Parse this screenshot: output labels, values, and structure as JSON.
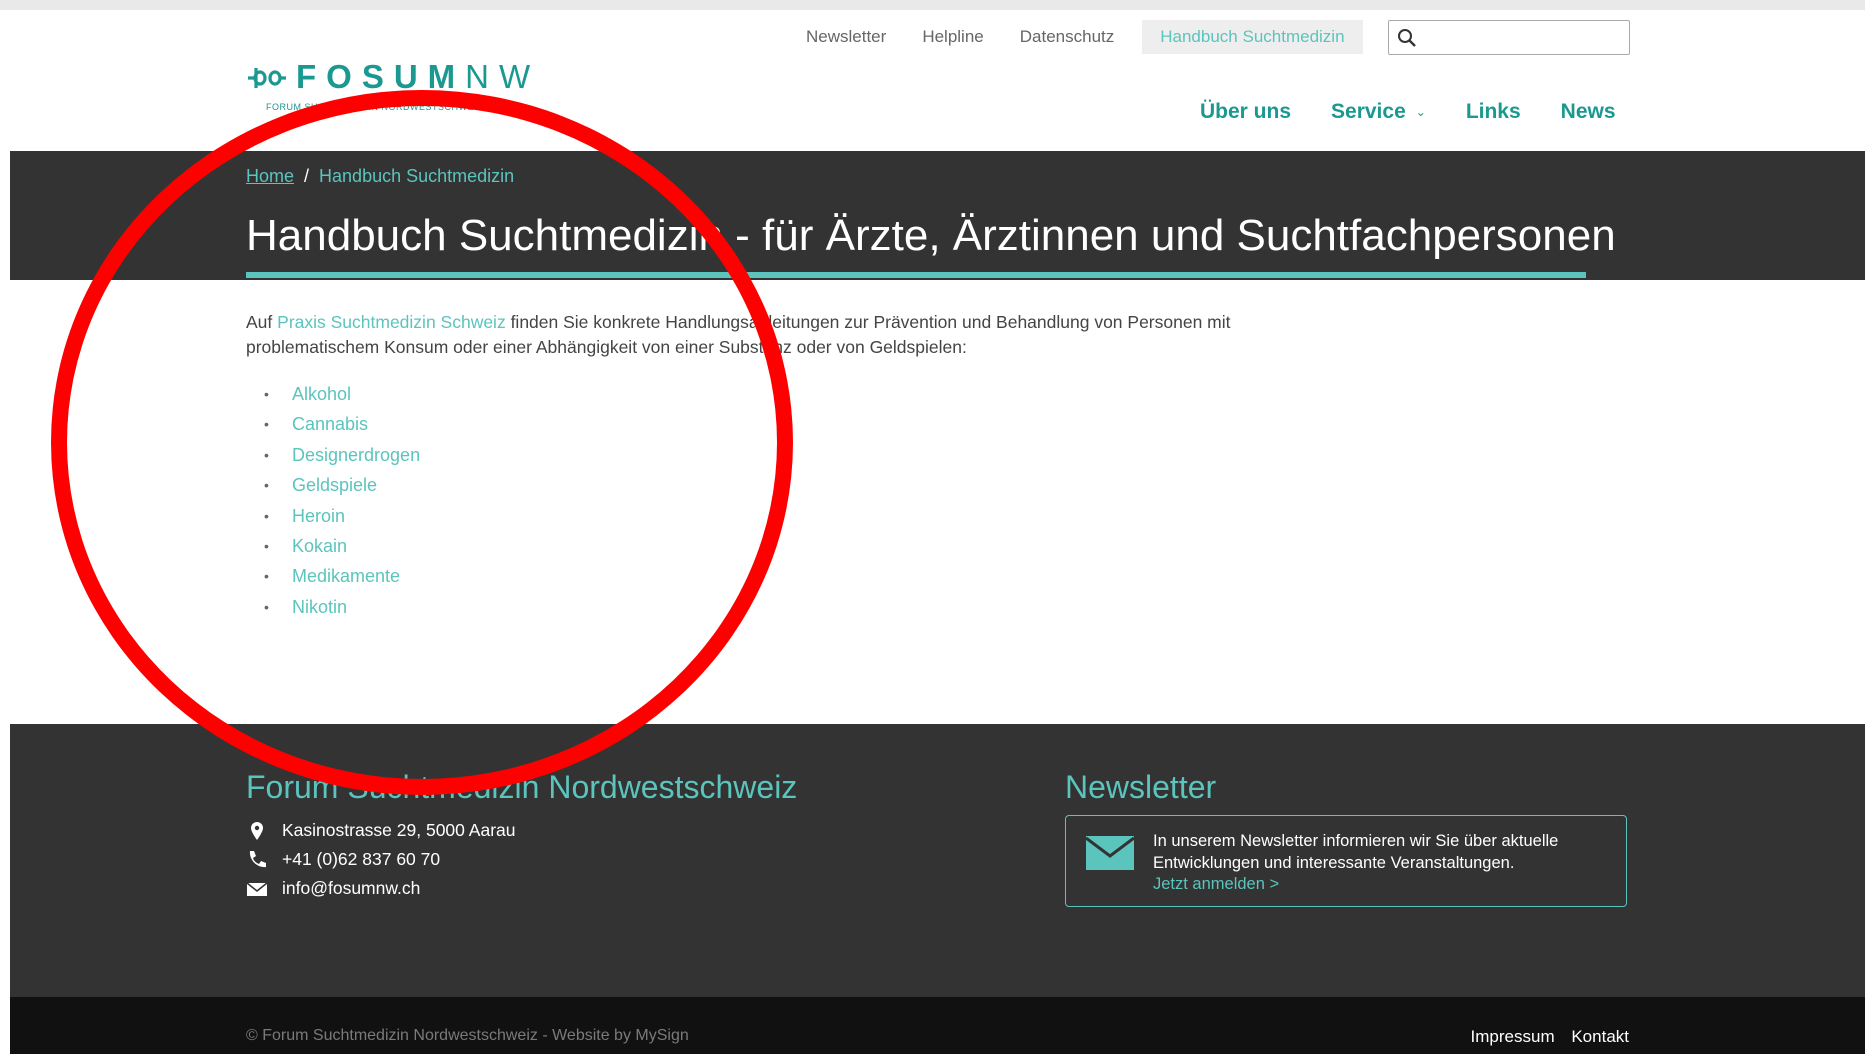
{
  "header": {
    "logo_name": "FOSUM",
    "logo_suffix": "NW",
    "logo_tagline": "FORUM SUCHTMEDIZIN NORDWESTSCHWEIZ",
    "top_links": [
      "Newsletter",
      "Helpline",
      "Datenschutz",
      "Handbuch Suchtmedizin"
    ],
    "search_placeholder": "",
    "main_nav": {
      "about": "Über uns",
      "service": "Service",
      "links": "Links",
      "news": "News"
    }
  },
  "hero": {
    "breadcrumb_home": "Home",
    "breadcrumb_separator": "/",
    "breadcrumb_current": "Handbuch Suchtmedizin",
    "title": "Handbuch Suchtmedizin - für Ärzte, Ärztinnen und Suchtfachpersonen"
  },
  "content": {
    "intro_before": "Auf ",
    "intro_link": "Praxis Suchtmedizin Schweiz",
    "intro_after": " finden Sie konkrete Handlungsanleitungen zur Prävention und Behandlung von Personen mit problematischem Konsum oder einer Abhängigkeit von einer Substanz oder von Geldspielen:",
    "topics": [
      "Alkohol",
      "Cannabis",
      "Designerdrogen",
      "Geldspiele",
      "Heroin",
      "Kokain",
      "Medikamente",
      "Nikotin"
    ]
  },
  "footer": {
    "org_title": "Forum Suchtmedizin Nordwestschweiz",
    "address": "Kasinostrasse 29, 5000 Aarau",
    "phone": "+41 (0)62 837 60 70",
    "email": "info@fosumnw.ch",
    "newsletter_title": "Newsletter",
    "newsletter_text": "In unserem Newsletter informieren wir Sie über aktuelle Entwicklungen und interessante Veranstaltungen.",
    "newsletter_link": "Jetzt anmelden >",
    "copyright": "© Forum Suchtmedizin Nordwestschweiz - Website by MySign",
    "impressum": "Impressum",
    "kontakt": "Kontakt"
  },
  "colors": {
    "accent": "#5bc4bd",
    "brand_dark": "#1b9991",
    "dark_bg": "#333333",
    "bottom_bg": "#111111",
    "annotation": "#ff0000"
  },
  "icons": [
    "logo-mark-icon",
    "search-icon",
    "chevron-down-icon",
    "map-pin-icon",
    "phone-icon",
    "envelope-icon"
  ]
}
